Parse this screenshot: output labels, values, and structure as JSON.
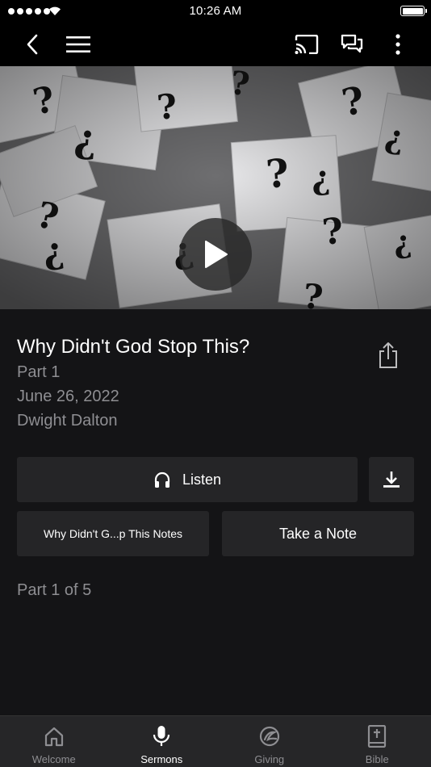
{
  "status_bar": {
    "time": "10:26 AM"
  },
  "nav": {
    "back_icon": "chevron-left-icon",
    "menu_icon": "hamburger-menu-icon",
    "cast_icon": "cast-icon",
    "chat_icon": "chat-bubbles-icon",
    "more_icon": "more-vertical-icon"
  },
  "sermon": {
    "title": "Why Didn't God Stop This?",
    "part": "Part 1",
    "date": "June 26, 2022",
    "speaker": "Dwight Dalton",
    "hero_image": "question marks on torn paper",
    "part_of": "Part 1 of 5"
  },
  "actions": {
    "listen_label": "Listen",
    "notes_label": "Why Didn't G...p This Notes",
    "take_note_label": "Take a Note"
  },
  "tabs": [
    {
      "label": "Welcome",
      "icon": "home-icon",
      "active": false
    },
    {
      "label": "Sermons",
      "icon": "microphone-icon",
      "active": true
    },
    {
      "label": "Giving",
      "icon": "giving-icon",
      "active": false
    },
    {
      "label": "Bible",
      "icon": "bible-icon",
      "active": false
    }
  ],
  "colors": {
    "background": "#141416",
    "button": "#252527",
    "muted_text": "#8e8e92",
    "tab_bar": "#262628"
  }
}
